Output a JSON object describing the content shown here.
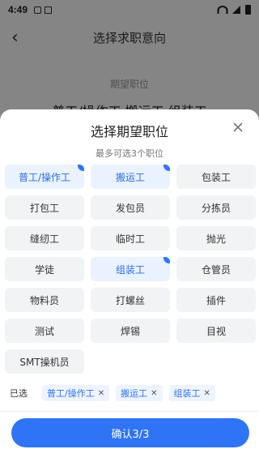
{
  "status_bar": {
    "time": "4:49"
  },
  "page": {
    "title": "选择求职意向",
    "field_label": "期望职位",
    "field_value": "普工/操作工 搬运工 组装工"
  },
  "sheet": {
    "title": "选择期望职位",
    "subtitle": "最多可选3个职位",
    "options": [
      {
        "label": "普工/操作工",
        "selected": true
      },
      {
        "label": "搬运工",
        "selected": true
      },
      {
        "label": "包装工",
        "selected": false
      },
      {
        "label": "打包工",
        "selected": false
      },
      {
        "label": "发包员",
        "selected": false
      },
      {
        "label": "分拣员",
        "selected": false
      },
      {
        "label": "缝纫工",
        "selected": false
      },
      {
        "label": "临时工",
        "selected": false
      },
      {
        "label": "抛光",
        "selected": false
      },
      {
        "label": "学徒",
        "selected": false
      },
      {
        "label": "组装工",
        "selected": true
      },
      {
        "label": "仓管员",
        "selected": false
      },
      {
        "label": "物料员",
        "selected": false
      },
      {
        "label": "打螺丝",
        "selected": false
      },
      {
        "label": "插件",
        "selected": false
      },
      {
        "label": "测试",
        "selected": false
      },
      {
        "label": "焊锡",
        "selected": false
      },
      {
        "label": "目视",
        "selected": false
      },
      {
        "label": "SMT操机员",
        "selected": false
      }
    ],
    "selected_label": "已选",
    "chips": [
      {
        "label": "普工/操作工"
      },
      {
        "label": "搬运工"
      },
      {
        "label": "组装工"
      }
    ],
    "confirm_label": "确认3/3"
  },
  "colors": {
    "accent": "#2f74f4",
    "chip_bg": "#eef4ff",
    "option_bg": "#f2f3f5"
  }
}
